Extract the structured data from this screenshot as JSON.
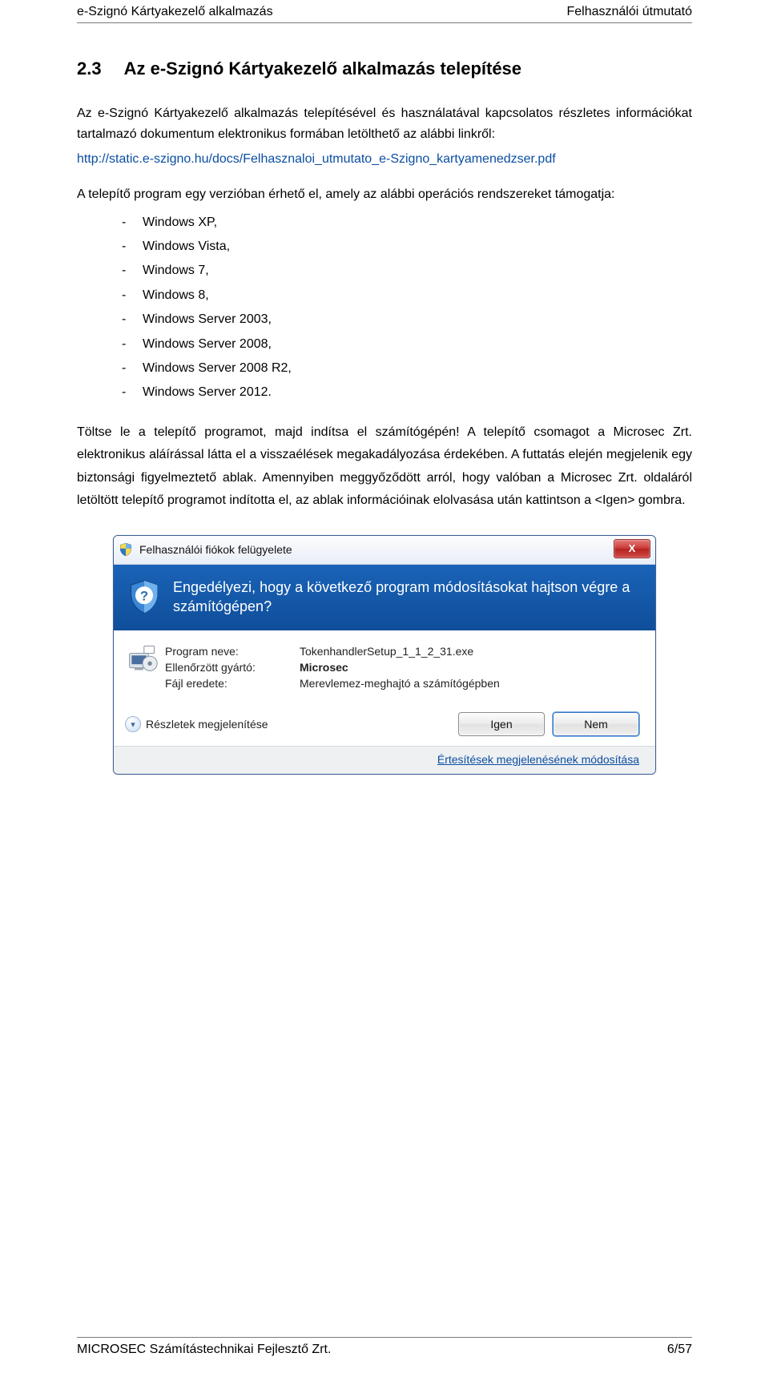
{
  "header": {
    "left": "e-Szignó Kártyakezelő alkalmazás",
    "right": "Felhasználói útmutató"
  },
  "section": {
    "number": "2.3",
    "title": "Az e-Szignó Kártyakezelő alkalmazás telepítése"
  },
  "para": {
    "intro": "Az e-Szignó Kártyakezelő alkalmazás telepítésével és használatával kapcsolatos részletes információkat tartalmazó dokumentum elektronikus formában letölthető az alábbi linkről:",
    "link": "http://static.e-szigno.hu/docs/Felhasznaloi_utmutato_e-Szigno_kartyamenedzser.pdf",
    "oslead": "A telepítő program egy verzióban érhető el, amely az alábbi operációs rendszereket támogatja:"
  },
  "oslist": [
    "Windows XP,",
    "Windows Vista,",
    "Windows 7,",
    "Windows 8,",
    "Windows Server 2003,",
    "Windows Server 2008,",
    "Windows Server 2008 R2,",
    "Windows Server 2012."
  ],
  "para2": "Töltse le a telepítő programot, majd indítsa el számítógépén!\nA telepítő csomagot a Microsec Zrt. elektronikus aláírással látta el a visszaélések megakadályozása érdekében. A futtatás elején megjelenik egy biztonsági figyelmeztető ablak. Amennyiben meggyőződött arról, hogy valóban a Microsec Zrt. oldaláról letöltött telepítő programot indította el, az ablak információinak elolvasása után kattintson a <Igen> gombra.",
  "uac": {
    "title": "Felhasználói fiókok felügyelete",
    "question": "Engedélyezi, hogy a következő program módosításokat hajtson végre a számítógépen?",
    "rows": {
      "program_label": "Program neve:",
      "program_value": "TokenhandlerSetup_1_1_2_31.exe",
      "publisher_label": "Ellenőrzött gyártó:",
      "publisher_value": "Microsec",
      "origin_label": "Fájl eredete:",
      "origin_value": "Merevlemez-meghajtó a számítógépben"
    },
    "details": "Részletek megjelenítése",
    "yes": "Igen",
    "no": "Nem",
    "footer_link": "Értesítések megjelenésének módosítása",
    "close_x": "X"
  },
  "footer": {
    "left": "MICROSEC Számítástechnikai Fejlesztő Zrt.",
    "right": "6/57"
  }
}
